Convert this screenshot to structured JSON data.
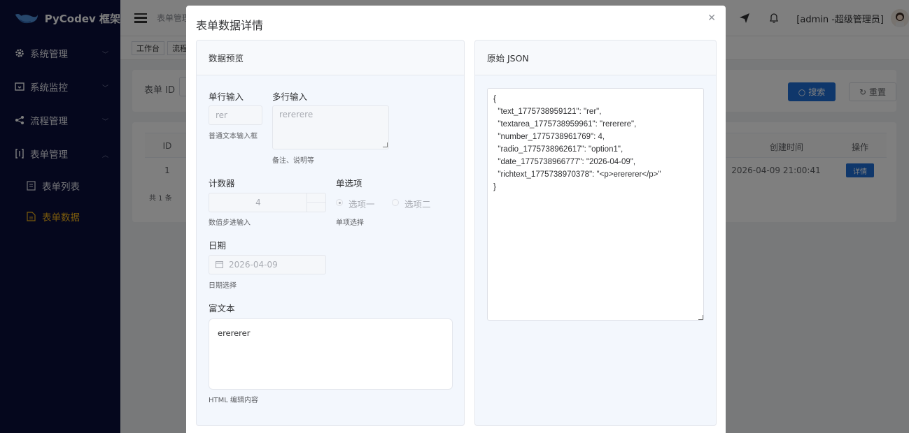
{
  "app": {
    "logo_text": "PyCodev 框架"
  },
  "sidebar": {
    "items": [
      {
        "label": "系统管理",
        "icon": "gear-icon"
      },
      {
        "label": "系统监控",
        "icon": "monitor-icon"
      },
      {
        "label": "流程管理",
        "icon": "share-icon"
      },
      {
        "label": "表单管理",
        "icon": "form-icon"
      }
    ],
    "sub_items": [
      {
        "label": "表单列表",
        "icon": "list-icon"
      },
      {
        "label": "表单数据",
        "icon": "document-icon"
      }
    ]
  },
  "header": {
    "breadcrumb": "表单管理",
    "user": "[admin -超级管理员]"
  },
  "tags": [
    "工作台",
    "流程"
  ],
  "search": {
    "label": "表单 ID",
    "search_btn": "搜索",
    "reset_btn": "重置"
  },
  "table": {
    "headers": {
      "id": "ID",
      "created": "创建时间",
      "ops": "操作"
    },
    "row": {
      "id": "1",
      "created": "2026-04-09 21:00:41",
      "detail": "详情"
    },
    "total": "共 1 条"
  },
  "dialog": {
    "title": "表单数据详情",
    "preview_title": "数据预览",
    "json_title": "原始 JSON",
    "fields": {
      "single_label": "单行输入",
      "single_value": "rer",
      "single_hint": "普通文本输入框",
      "multi_label": "多行输入",
      "multi_value": "rererere",
      "multi_hint": "备注、说明等",
      "counter_label": "计数器",
      "counter_value": "4",
      "counter_hint": "数值步进输入",
      "radio_label": "单选项",
      "radio_opt1": "选项一",
      "radio_opt2": "选项二",
      "radio_hint": "单项选择",
      "date_label": "日期",
      "date_value": "2026-04-09",
      "date_hint": "日期选择",
      "rich_label": "富文本",
      "rich_value": "erererer",
      "rich_hint": "HTML 编辑内容"
    },
    "json_text": "{\n  \"text_1775738959121\": \"rer\",\n  \"textarea_1775738959961\": \"rererere\",\n  \"number_1775738961769\": 4,\n  \"radio_1775738962617\": \"option1\",\n  \"date_1775738966777\": \"2026-04-09\",\n  \"richtext_1775738970378\": \"<p>erererer</p>\"\n}"
  }
}
